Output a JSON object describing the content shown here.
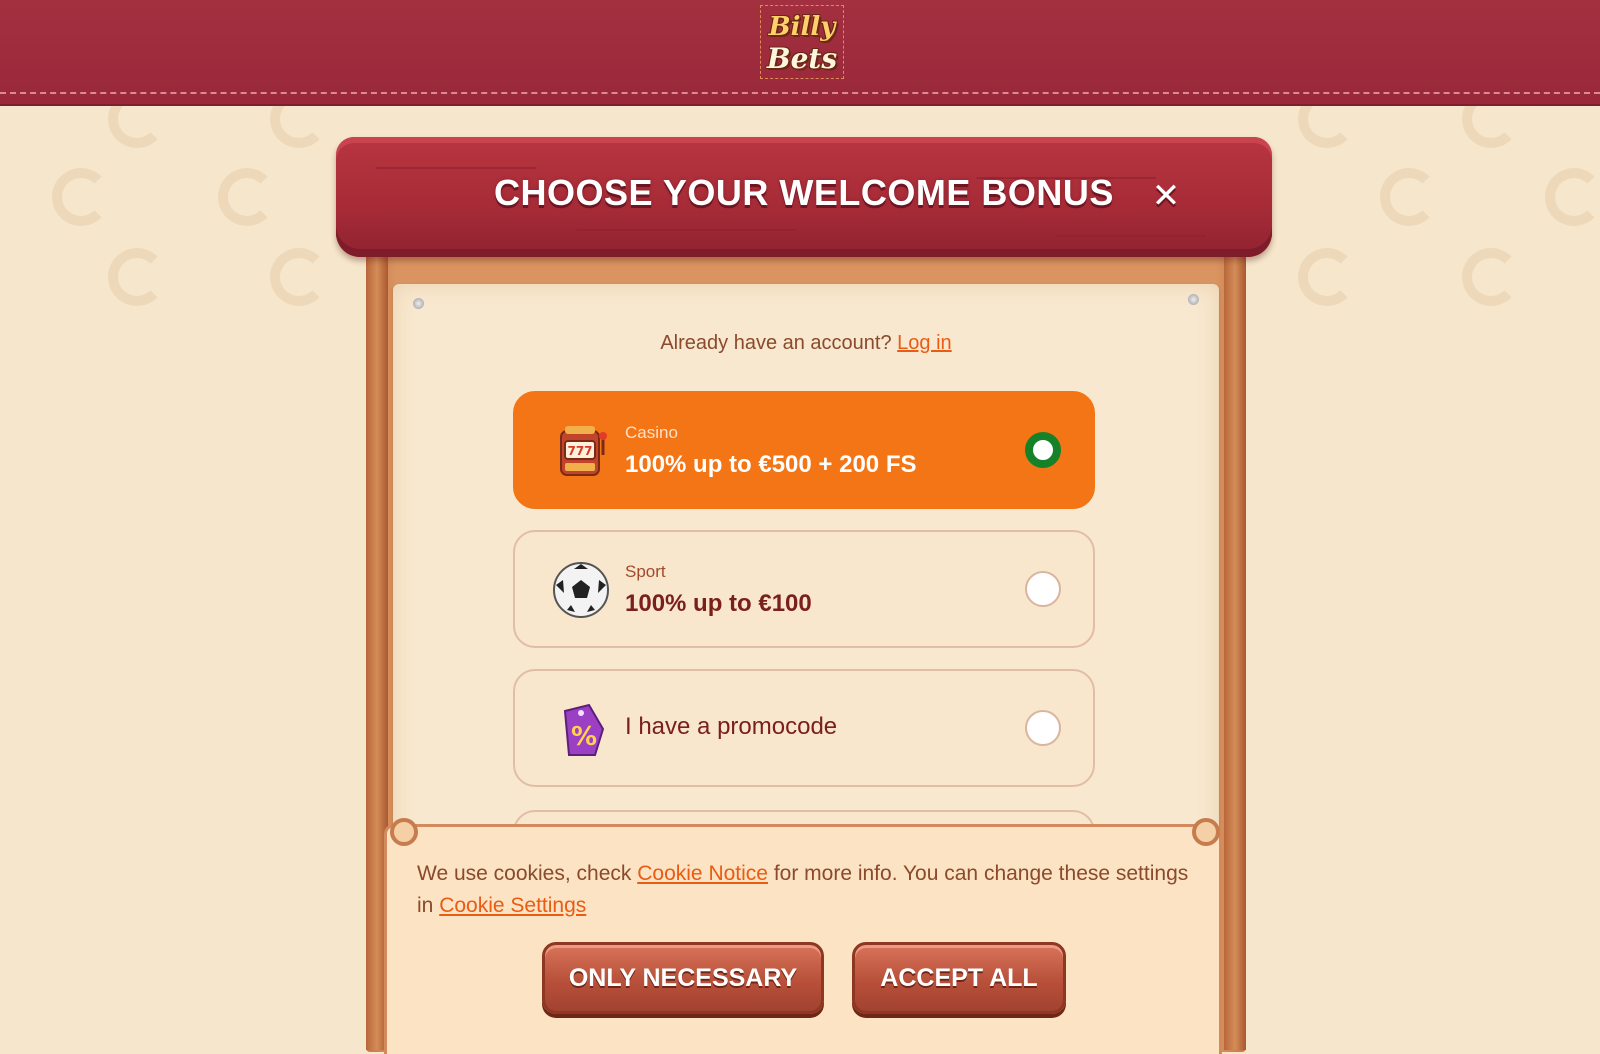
{
  "header": {
    "logo_top": "Billy",
    "logo_bottom": "Bets"
  },
  "modal": {
    "title": "CHOOSE YOUR WELCOME BONUS",
    "close_icon": "close-icon",
    "already_text": "Already have an account?",
    "login_link": "Log in"
  },
  "options": [
    {
      "category": "Casino",
      "amount": "100% up to €500 + 200 FS",
      "icon": "slot-machine-icon",
      "selected": true
    },
    {
      "category": "Sport",
      "amount": "100% up to €100",
      "icon": "soccer-ball-icon",
      "selected": false
    },
    {
      "label": "I have a promocode",
      "icon": "percent-tag-icon",
      "selected": false
    }
  ],
  "cookie": {
    "text_1": "We use cookies, check",
    "link_notice": "Cookie Notice",
    "text_2": "for more info. You can change these settings in",
    "link_settings": "Cookie Settings",
    "btn_necessary": "ONLY NECESSARY",
    "btn_accept": "ACCEPT ALL"
  },
  "colors": {
    "accent": "#f47515",
    "header": "#a3303f",
    "radio_checked": "#15822a",
    "background": "#f6e6cc"
  }
}
